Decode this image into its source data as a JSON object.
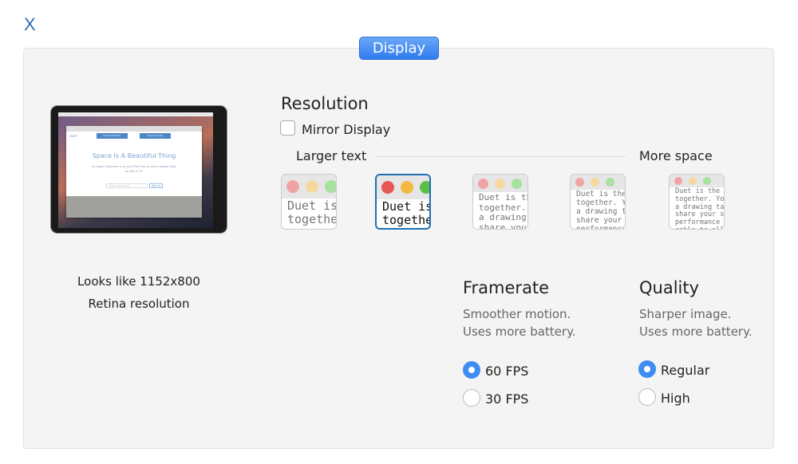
{
  "close_label": "X",
  "tab_label": "Display",
  "preview": {
    "site_logo": "duet",
    "download_mac": "Download Mac",
    "download_pc": "Download PC",
    "headline": "Space Is A Beautiful Thing",
    "subline": "Ex Apple Engineers turn your iPad into an extra display. Now for Mac & PC",
    "email_placeholder": "Enter Your Email...",
    "signup": "Sign Up",
    "looks_like": "Looks like 1152x800",
    "retina": "Retina resolution"
  },
  "resolution": {
    "title": "Resolution",
    "mirror_label": "Mirror Display",
    "mirror_checked": false,
    "left_label": "Larger text",
    "right_label": "More space",
    "selected_index": 1,
    "options": [
      {
        "text": "Duet is\ntogether"
      },
      {
        "text": "Duet is\ntogether\na drawi"
      },
      {
        "text": "Duet is the\ntogether.\na drawing\nshare your"
      },
      {
        "text": "Duet is the\ntogether. You\na drawing ta\nshare your s\nperformance"
      },
      {
        "text": "Duet is the be\ntogether. You\na drawing tabl\nshare your scr\nperformance sc\ncable to allow"
      }
    ]
  },
  "framerate": {
    "title": "Framerate",
    "desc1": "Smoother motion.",
    "desc2": "Uses more battery.",
    "options": [
      "60 FPS",
      "30 FPS"
    ],
    "selected": "60 FPS"
  },
  "quality": {
    "title": "Quality",
    "desc1": "Sharper image.",
    "desc2": "Uses more battery.",
    "options": [
      "Regular",
      "High"
    ],
    "selected": "Regular"
  },
  "colors": {
    "accent": "#3f8cf2",
    "selected_border": "#1f6fb3",
    "close": "#2a6fb0"
  }
}
